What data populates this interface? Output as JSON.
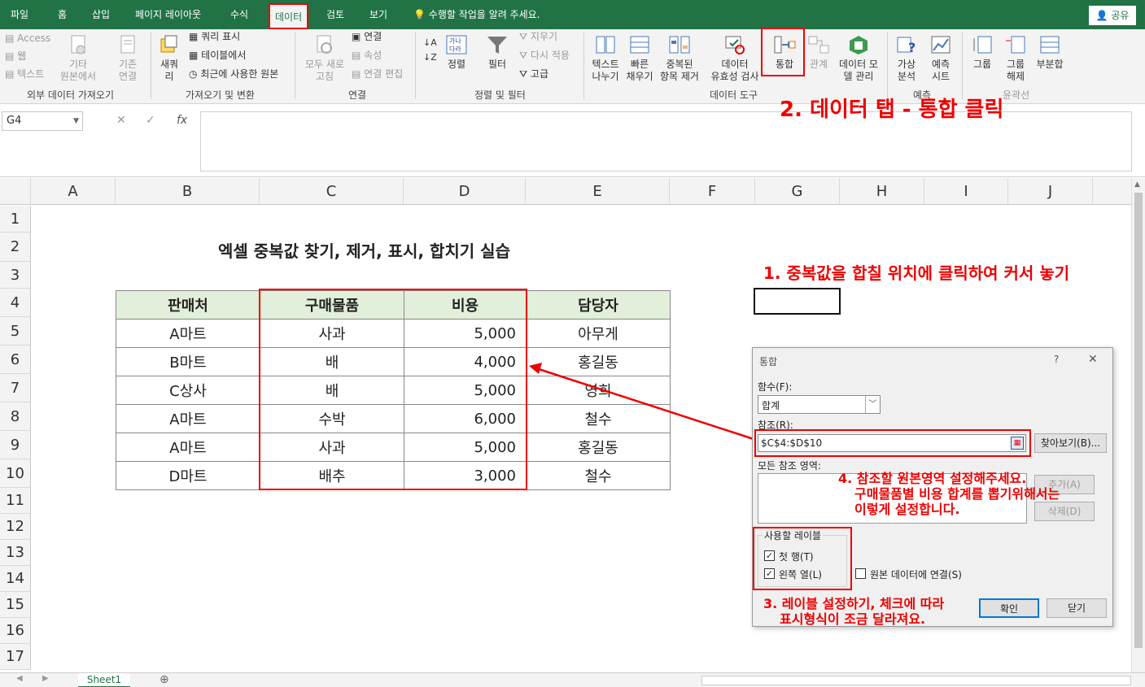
{
  "tabs": [
    "파일",
    "홈",
    "삽입",
    "페이지 레이아웃",
    "수식",
    "데이터",
    "검토",
    "보기"
  ],
  "tell_me": "수행할 작업을 알려 주세요.",
  "share": "공유",
  "ribbon": {
    "ext": {
      "access": "Access",
      "web": "웹",
      "text": "텍스트",
      "other": "기타\n원본에서",
      "existing": "기존\n연결",
      "group": "외부 데이터 가져오기"
    },
    "get": {
      "new_query": "새쿼\n리",
      "show_query": "쿼리 표시",
      "from_table": "테이블에서",
      "recent": "최근에 사용한 원본",
      "group": "가져오기 및 변환"
    },
    "conn": {
      "refresh_all": "모두 새로\n고침",
      "connections": "연결",
      "properties": "속성",
      "edit_links": "연결 편집",
      "group": "연결"
    },
    "sort": {
      "sort": "정렬",
      "filter": "필터",
      "clear": "지우기",
      "reapply": "다시 적용",
      "advanced": "고급",
      "group": "정렬 및 필터"
    },
    "tools": {
      "text_to_col": "텍스트\n나누기",
      "flash_fill": "빠른\n채우기",
      "remove_dup": "중복된\n항목 제거",
      "validation": "데이터\n유효성 검사",
      "consolidate": "통합",
      "relationships": "관계",
      "data_model": "데이터 모\n델 관리",
      "group": "데이터 도구"
    },
    "forecast": {
      "what_if": "가상\n분석",
      "sheet": "예측\n시트",
      "group": "예측"
    },
    "outline": {
      "group_btn": "그룹",
      "ungroup": "그룹\n해제",
      "subtotal": "부분합",
      "group": "윤곽선"
    }
  },
  "name_box": "G4",
  "fx_symbols": {
    "cancel": "✕",
    "enter": "✓",
    "fx": "fx"
  },
  "columns": [
    "A",
    "B",
    "C",
    "D",
    "E",
    "F",
    "G",
    "H",
    "I",
    "J"
  ],
  "rows": [
    "1",
    "2",
    "3",
    "4",
    "5",
    "6",
    "7",
    "8",
    "9",
    "10",
    "11",
    "12",
    "13",
    "14",
    "15",
    "16",
    "17"
  ],
  "sheet_title": "엑셀 중복값 찾기, 제거, 표시, 합치기 실습",
  "table": {
    "headers": [
      "판매처",
      "구매물품",
      "비용",
      "담당자"
    ],
    "rows": [
      [
        "A마트",
        "사과",
        "5,000",
        "아무게"
      ],
      [
        "B마트",
        "배",
        "4,000",
        "홍길동"
      ],
      [
        "C상사",
        "배",
        "5,000",
        "영희"
      ],
      [
        "A마트",
        "수박",
        "6,000",
        "철수"
      ],
      [
        "A마트",
        "사과",
        "5,000",
        "홍길동"
      ],
      [
        "D마트",
        "배추",
        "3,000",
        "철수"
      ]
    ]
  },
  "sheet_tab": "Sheet1",
  "annotations": {
    "step1": "1. 중복값을 합칠 위치에 클릭하여 커서 놓기",
    "step2": "2. 데이터 탭 - 통합 클릭",
    "step3_l1": "3. 레이블 설정하기, 체크에 따라",
    "step3_l2": "표시형식이 조금 달라져요.",
    "step4_l1": "4. 참조할 원본영역 설정해주세요.",
    "step4_l2": "구매물품별 비용 합계를 뽑기위해서는",
    "step4_l3": "이렇게 설정합니다."
  },
  "dialog": {
    "title": "통합",
    "help": "?",
    "close": "✕",
    "function_label": "함수(F):",
    "function_value": "합계",
    "reference_label": "참조(R):",
    "reference_value": "$C$4:$D$10",
    "browse": "찾아보기(B)...",
    "all_refs_label": "모든 참조 영역:",
    "add": "추가(A)",
    "delete": "삭제(D)",
    "labels_group": "사용할 레이블",
    "top_row": "첫 행(T)",
    "left_col": "왼쪽 열(L)",
    "link_source": "원본 데이터에 연결(S)",
    "ok": "확인",
    "close_btn": "닫기"
  },
  "colors": {
    "excel_green": "#217346",
    "header_fill": "#e2efda",
    "annotation_red": "#ee0000"
  }
}
